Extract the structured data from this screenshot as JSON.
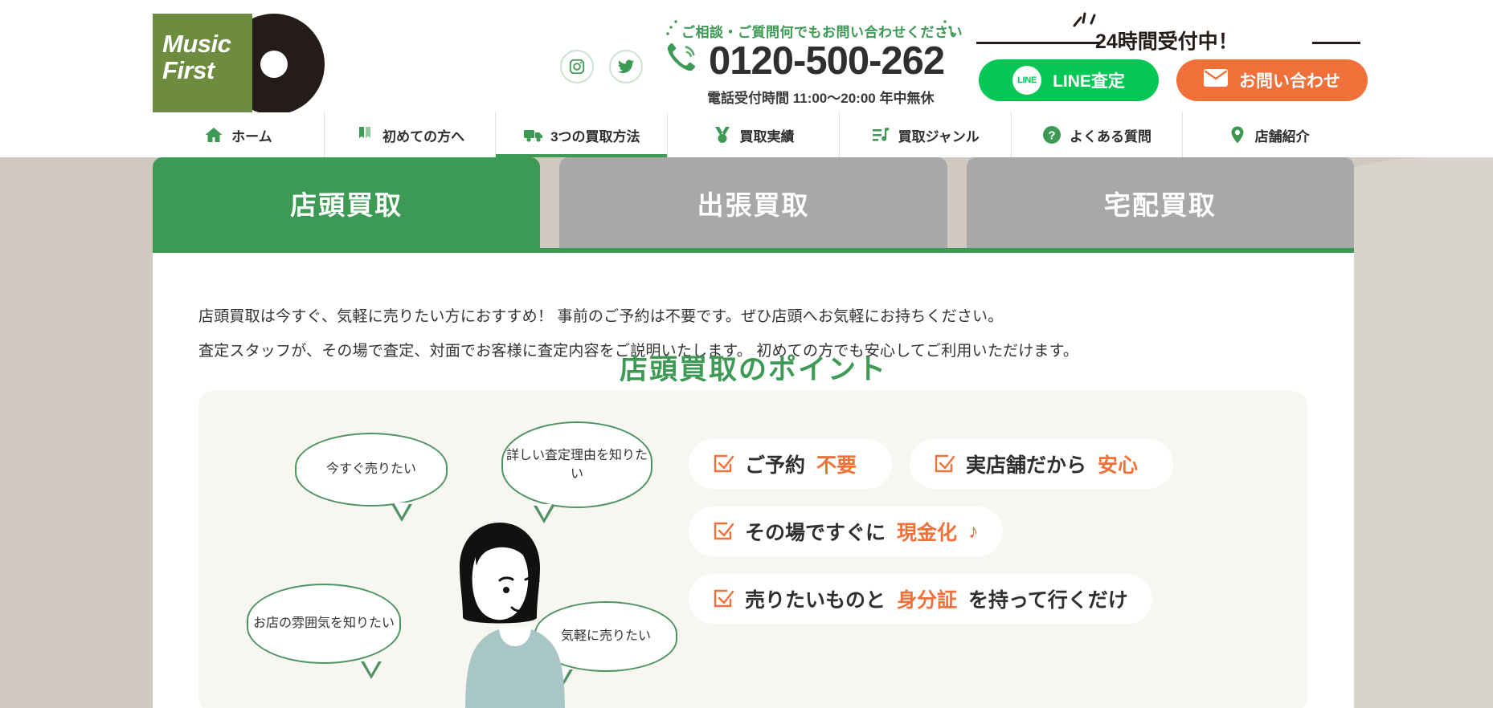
{
  "brand": {
    "line1": "Music",
    "line2": "First",
    "green": "#6d8c3f"
  },
  "header": {
    "tagline": "ご相談・ご質問何でもお問い合わせください",
    "phone": "0120-500-262",
    "hours": "電話受付時間 11:00〜20:00 年中無休",
    "badge_24h": "24時間受付中！",
    "line_button": "LINE査定",
    "line_badge": "LINE",
    "mail_button": "お問い合わせ",
    "social": [
      {
        "name": "instagram-icon"
      },
      {
        "name": "twitter-icon"
      }
    ],
    "colors": {
      "line_green": "#06c755",
      "orange": "#f0703a",
      "accent_green": "#3d9a54"
    }
  },
  "nav": {
    "items": [
      {
        "label": "ホーム",
        "icon": "home-icon",
        "active": false
      },
      {
        "label": "初めての方へ",
        "icon": "book-icon",
        "active": false
      },
      {
        "label": "3つの買取方法",
        "icon": "truck-icon",
        "active": true
      },
      {
        "label": "買取実績",
        "icon": "award-icon",
        "active": false
      },
      {
        "label": "買取ジャンル",
        "icon": "list-music-icon",
        "active": false
      },
      {
        "label": "よくある質問",
        "icon": "question-icon",
        "active": false
      },
      {
        "label": "店舗紹介",
        "icon": "map-pin-icon",
        "active": false
      }
    ]
  },
  "tabs": [
    {
      "label": "店頭買取",
      "active": true
    },
    {
      "label": "出張買取",
      "active": false
    },
    {
      "label": "宅配買取",
      "active": false
    }
  ],
  "main": {
    "paragraphs": [
      "店頭買取は今すぐ、気軽に売りたい方におすすめ！ 事前のご予約は不要です。ぜひ店頭へお気軽にお持ちください。",
      "査定スタッフが、その場で査定、対面でお客様に査定内容をご説明いたします。 初めての方でも安心してご利用いただけます。"
    ],
    "section_title": "店頭買取のポイント",
    "bubbles": [
      {
        "text": "今すぐ売りたい"
      },
      {
        "text": "詳しい査定理由を知りたい"
      },
      {
        "text": "お店の雰囲気を知りたい"
      },
      {
        "text": "気軽に売りたい"
      }
    ],
    "checklist": [
      [
        {
          "text": "ご予約",
          "highlight": "不要",
          "tail": ""
        },
        {
          "text": "実店舗だから",
          "highlight": "安心",
          "tail": ""
        }
      ],
      [
        {
          "text": "その場ですぐに",
          "highlight": "現金化",
          "tail": "♪"
        }
      ],
      [
        {
          "text": "売りたいものと",
          "highlight": "身分証",
          "tail": "を持って行くだけ"
        }
      ]
    ]
  }
}
